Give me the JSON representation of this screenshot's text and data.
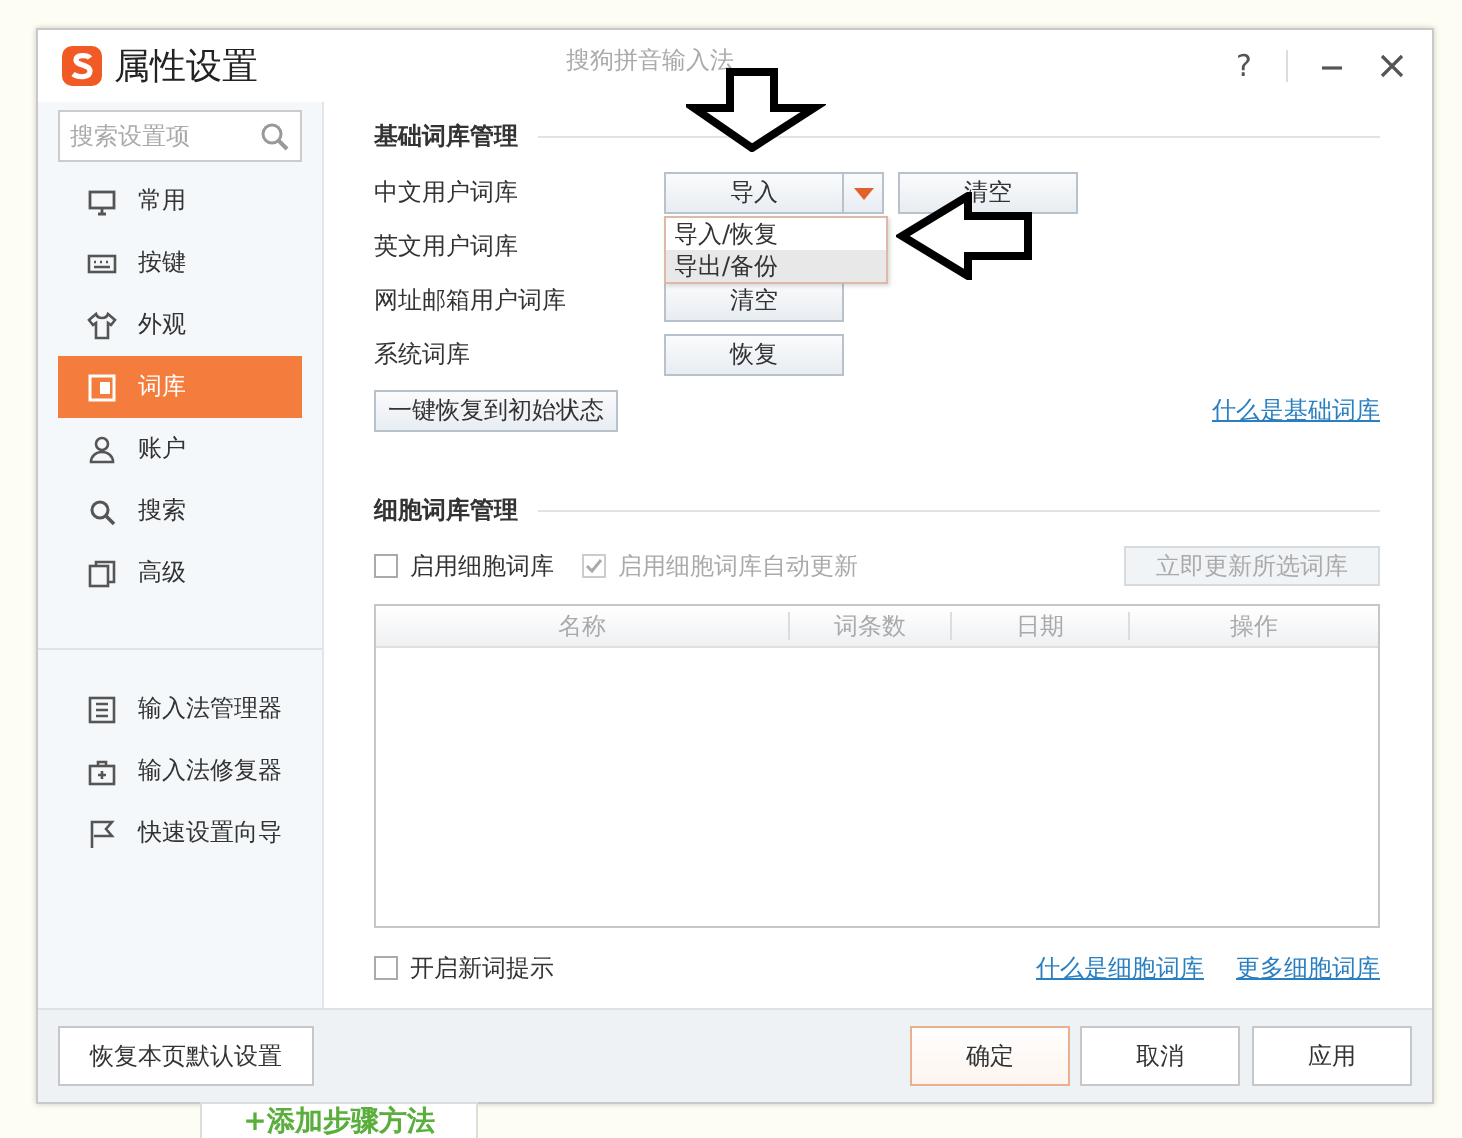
{
  "window": {
    "title": "属性设置",
    "app_name": "搜狗拼音输入法",
    "help": "?"
  },
  "sidebar": {
    "search": {
      "placeholder": "搜索设置项"
    },
    "items": [
      {
        "label": "常用",
        "selected": false
      },
      {
        "label": "按键",
        "selected": false
      },
      {
        "label": "外观",
        "selected": false
      },
      {
        "label": "词库",
        "selected": true
      },
      {
        "label": "账户",
        "selected": false
      },
      {
        "label": "搜索",
        "selected": false
      },
      {
        "label": "高级",
        "selected": false
      }
    ],
    "tools": [
      {
        "label": "输入法管理器"
      },
      {
        "label": "输入法修复器"
      },
      {
        "label": "快速设置向导"
      }
    ]
  },
  "basic": {
    "title": "基础词库管理",
    "rows": [
      {
        "label": "中文用户词库",
        "buttons": [
          {
            "label": "导入",
            "dropdown": true
          },
          {
            "label": "清空",
            "dropdown": false
          }
        ]
      },
      {
        "label": "英文用户词库",
        "buttons": []
      },
      {
        "label": "网址邮箱用户词库",
        "buttons": [
          {
            "label": "清空",
            "dropdown": false
          }
        ]
      },
      {
        "label": "系统词库",
        "buttons": [
          {
            "label": "恢复",
            "dropdown": false
          }
        ]
      }
    ],
    "reset_button": "一键恢复到初始状态",
    "link": "什么是基础词库",
    "menu": [
      {
        "label": "导入/恢复",
        "selected": false
      },
      {
        "label": "导出/备份",
        "selected": true
      }
    ]
  },
  "cell": {
    "title": "细胞词库管理",
    "checkboxes": [
      {
        "label": "启用细胞词库",
        "checked": false,
        "disabled": false
      },
      {
        "label": "启用细胞词库自动更新",
        "checked": true,
        "disabled": true
      }
    ],
    "update_button": {
      "label": "立即更新所选词库",
      "disabled": true
    },
    "columns": [
      "名称",
      "词条数",
      "日期",
      "操作"
    ],
    "new_word": {
      "label": "开启新词提示",
      "checked": false
    },
    "links": [
      "什么是细胞词库",
      "更多细胞词库"
    ]
  },
  "footer": {
    "restore_button": "恢复本页默认设置",
    "buttons": [
      {
        "label": "确定",
        "primary": true
      },
      {
        "label": "取消",
        "primary": false
      },
      {
        "label": "应用",
        "primary": false
      }
    ]
  },
  "page_tab": "+添加步骤方法",
  "annotations": [
    {
      "kind": "down"
    },
    {
      "kind": "left"
    }
  ]
}
